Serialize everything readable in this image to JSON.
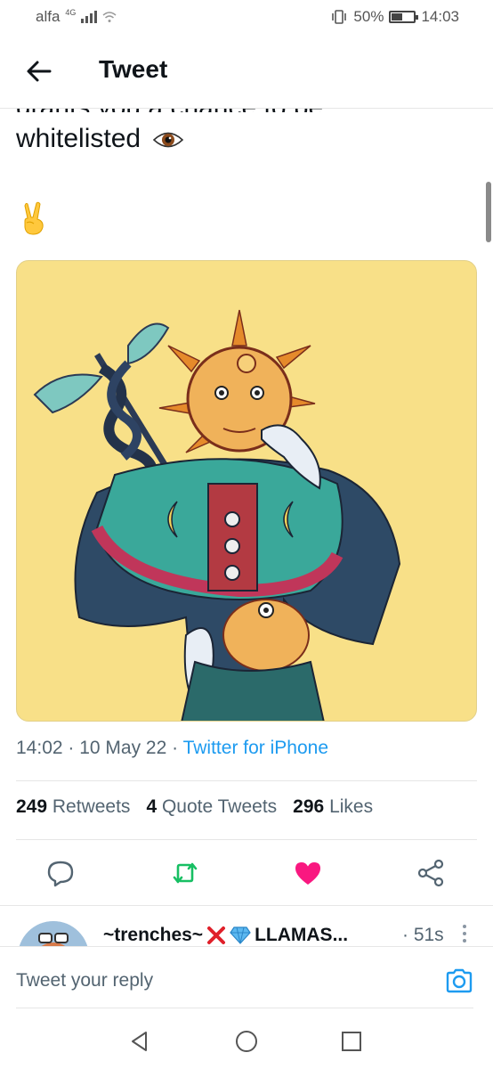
{
  "status_bar": {
    "carrier": "alfa",
    "network": "4G",
    "battery": "50%",
    "battery_level": 0.5,
    "time": "14:03"
  },
  "header": {
    "title": "Tweet",
    "back_icon": "arrow-left-icon"
  },
  "tweet": {
    "text_partial_line": "grants you a chance to be",
    "text_line": "whitelisted",
    "emoji_eye": "eye-emoji",
    "emoji_hand": "victory-hand-emoji",
    "image_alt": "illustrated sun-faced figure with caduceus on yellow background",
    "time": "14:02",
    "date": "10 May 22",
    "source": "Twitter for iPhone",
    "retweets_count": "249",
    "retweets_label": "Retweets",
    "quotes_count": "4",
    "quotes_label": "Quote Tweets",
    "likes_count": "296",
    "likes_label": "Likes"
  },
  "actions": {
    "reply_icon": "reply-icon",
    "retweet_icon": "retweet-icon",
    "like_icon": "heart-icon",
    "share_icon": "share-icon",
    "colors": {
      "retweet": "#17bf63",
      "like": "#f91880",
      "default": "#536471"
    }
  },
  "reply_preview": {
    "name": "~trenches~",
    "name_suffix": "LLAMAS...",
    "time": "· 51s"
  },
  "composer": {
    "placeholder": "Tweet your reply",
    "camera_icon": "camera-icon"
  },
  "navbar": {
    "back_icon": "triangle-back-icon",
    "home_icon": "circle-home-icon",
    "recent_icon": "square-recent-icon"
  }
}
